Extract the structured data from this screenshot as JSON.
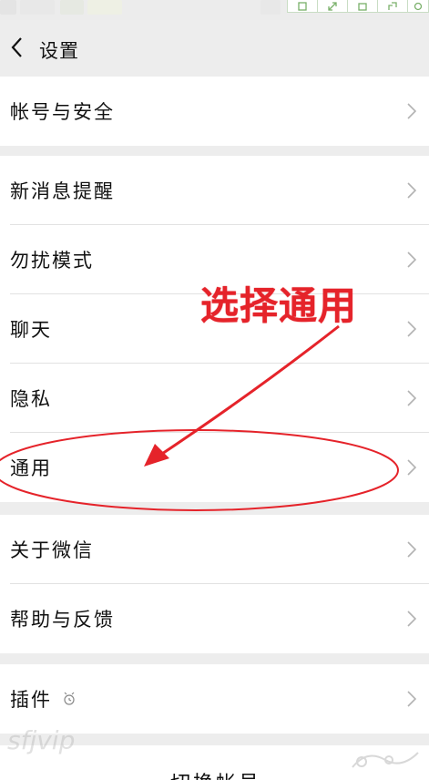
{
  "header": {
    "title": "设置"
  },
  "groups": [
    {
      "items": [
        {
          "label": "帐号与安全"
        }
      ]
    },
    {
      "items": [
        {
          "label": "新消息提醒"
        },
        {
          "label": "勿扰模式"
        },
        {
          "label": "聊天"
        },
        {
          "label": "隐私"
        },
        {
          "label": "通用"
        }
      ]
    },
    {
      "items": [
        {
          "label": "关于微信"
        },
        {
          "label": "帮助与反馈"
        }
      ]
    },
    {
      "items": [
        {
          "label": "插件"
        }
      ]
    }
  ],
  "annotation": {
    "text": "选择通用",
    "color": "#e5232a"
  },
  "footer": {
    "switch_account": "切换帐号"
  },
  "watermark": "sfjvip",
  "colors": {
    "background": "#ededed",
    "row": "#ffffff",
    "chevron": "#b2b2b2"
  }
}
